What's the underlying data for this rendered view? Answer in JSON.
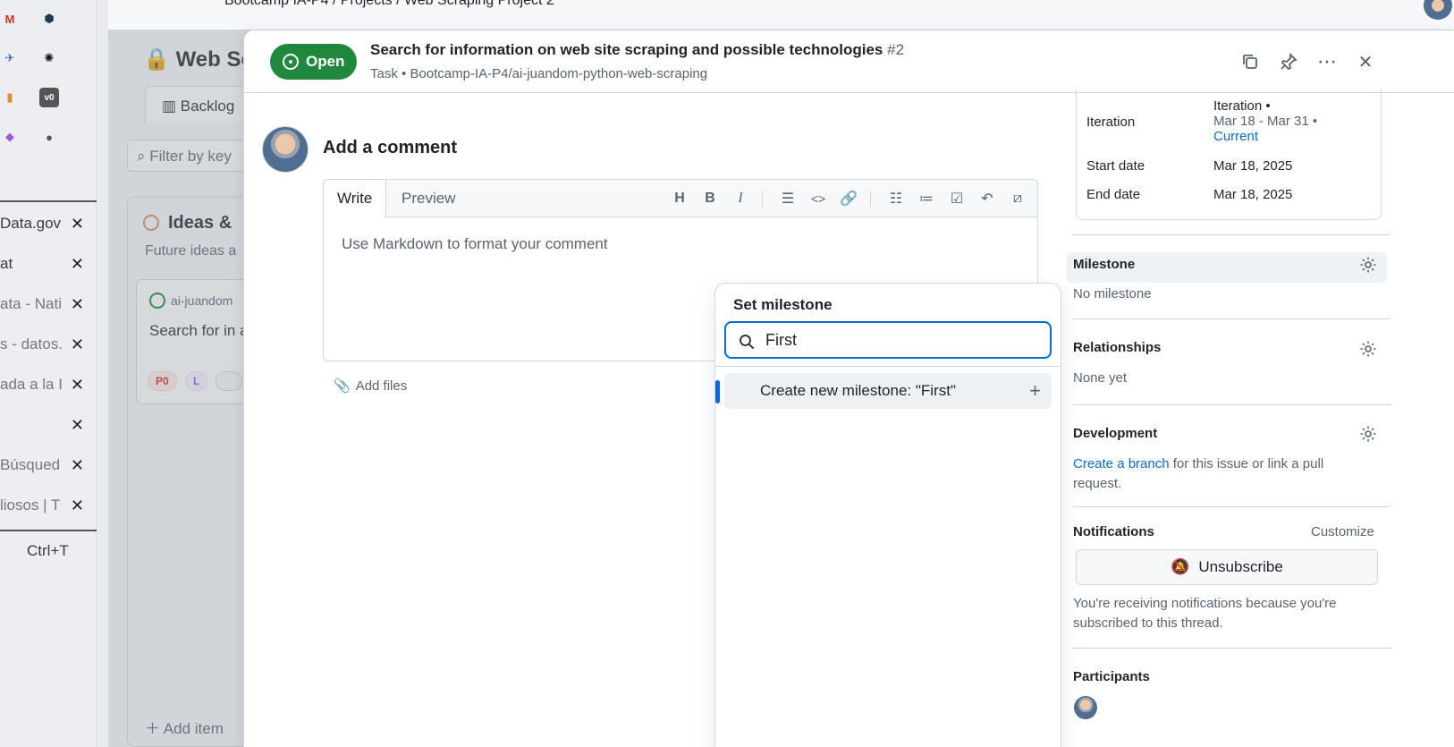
{
  "browser": {
    "vertical_tabs": [
      {
        "label": "Data.gov"
      },
      {
        "label": "at"
      },
      {
        "label": "ata - Nati"
      },
      {
        "label": "s - datos."
      },
      {
        "label": "ada a la I"
      },
      {
        "label": ""
      },
      {
        "label": "Búsqued"
      },
      {
        "label": "liosos | T"
      }
    ],
    "close_glyph": "✕",
    "new_tab_shortcut": "Ctrl+T"
  },
  "background_page": {
    "project_title": "Web Sc",
    "view_tab": "Backlog",
    "filter_placeholder": "Filter by key",
    "column_title": "Ideas &",
    "column_subtitle": "Future ideas a",
    "card_repo": "ai-juandom",
    "card_title": "Search for in and possible",
    "card_labels": [
      "P0",
      "L",
      ""
    ],
    "add_item": "Add item",
    "breadcrumb": "Bootcamp IA-P4  /  Projects  /  Web Scraping Project 2"
  },
  "issue": {
    "status": "Open",
    "title": "Search for information on web site scraping and possible technologies",
    "number": "#2",
    "type": "Task",
    "repo": "Bootcamp-IA-P4/ai-juandom-python-web-scraping"
  },
  "comment": {
    "heading": "Add a comment",
    "tab_write": "Write",
    "tab_preview": "Preview",
    "placeholder": "Use Markdown to format your comment",
    "add_files": "Add files"
  },
  "milestone_dropdown": {
    "title": "Set milestone",
    "search_value": "First",
    "create_item": "Create new milestone: \"First\""
  },
  "sidebar": {
    "iteration_label": "Iteration",
    "iteration_value_line1": "Iteration •",
    "iteration_value_line2": "Mar 18 - Mar 31 •",
    "iteration_current": "Current",
    "start_date_label": "Start date",
    "start_date": "Mar 18, 2025",
    "end_date_label": "End date",
    "end_date": "Mar 18, 2025",
    "milestone_head": "Milestone",
    "milestone_value": "No milestone",
    "relationships_head": "Relationships",
    "relationships_value": "None yet",
    "development_head": "Development",
    "development_link": "Create a branch",
    "development_text": " for this issue or link a pull request.",
    "notifications_head": "Notifications",
    "customize": "Customize",
    "unsubscribe": "Unsubscribe",
    "notify_text": "You're receiving notifications because you're subscribed to this thread.",
    "participants_head": "Participants"
  },
  "colors": {
    "open_green": "#1f883d",
    "link_blue": "#0969da",
    "focus_blue": "#0969da"
  }
}
